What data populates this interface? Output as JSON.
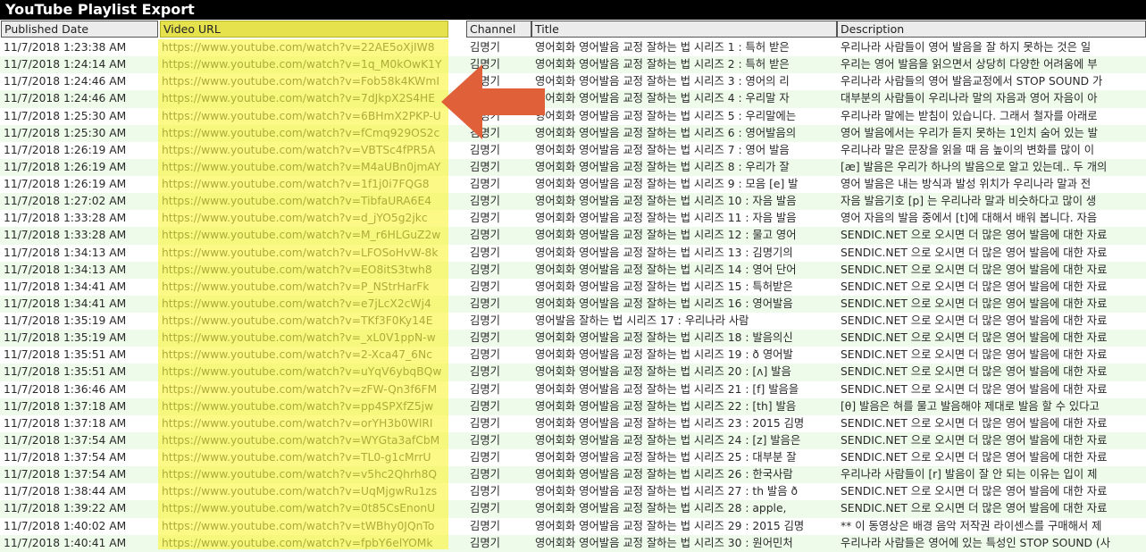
{
  "window": {
    "title": "YouTube Playlist Export"
  },
  "columns": [
    "Published Date",
    "Video URL",
    "Channel",
    "Title",
    "Description"
  ],
  "colors": {
    "url_highlight": "#f6f23c",
    "arrow": "#e0603a",
    "row_alt": "#eefbea"
  },
  "annotation": {
    "arrow_icon": "left-arrow-icon"
  },
  "rows": [
    {
      "date": "11/7/2018 1:23:38 AM",
      "url": "https://www.youtube.com/watch?v=22AE5oXjIW8",
      "channel": "김명기",
      "title": "영어회화 영어발음 교정 잘하는 법 시리즈 1 : 특허 받은",
      "desc": "우리나라 사람들이 영어 발음을 잘 하지 못하는 것은 일"
    },
    {
      "date": "11/7/2018 1:24:14 AM",
      "url": "https://www.youtube.com/watch?v=1q_M0kOwK1Y",
      "channel": "김명기",
      "title": "영어회화 영어발음 교정 잘하는 법 시리즈 2 : 특허 받은",
      "desc": "우리는 영어 발음을 읽으면서 상당히 다양한 어려움에 부"
    },
    {
      "date": "11/7/2018 1:24:46 AM",
      "url": "https://www.youtube.com/watch?v=Fob58k4KWmI",
      "channel": "김명기",
      "title": "영어회화 영어발음 교정 잘하는 법 시리즈 3 : 영어의 리",
      "desc": "우리나라 사람들의 영어 발음교정에서 STOP SOUND 가"
    },
    {
      "date": "11/7/2018 1:24:46 AM",
      "url": "https://www.youtube.com/watch?v=7dJkpX2S4HE",
      "channel": "김명기",
      "title": "영어회화 영어발음 교정 잘하는 법 시리즈 4 : 우리말 자",
      "desc": "대부분의 사람들이 우리나라 말의 자음과 영어 자음이 아"
    },
    {
      "date": "11/7/2018 1:25:30 AM",
      "url": "https://www.youtube.com/watch?v=6BHmX2PKP-U",
      "channel": "김명기",
      "title": "영어회화 영어발음 교정 잘하는 법 시리즈 5 : 우리말에는",
      "desc": "우리나라 말에는 받침이 있습니다. 그래서 철자를 아래로"
    },
    {
      "date": "11/7/2018 1:25:30 AM",
      "url": "https://www.youtube.com/watch?v=fCmq929OS2c",
      "channel": "김명기",
      "title": "영어회화 영어발음 교정 잘하는 법 시리즈 6 : 영어발음의",
      "desc": "영어 발음에서는 우리가 듣지 못하는 1인치 숨어 있는 발"
    },
    {
      "date": "11/7/2018 1:26:19 AM",
      "url": "https://www.youtube.com/watch?v=VBTSc4fPR5A",
      "channel": "김명기",
      "title": "영어회화 영어발음 교정 잘하는 법 시리즈 7 : 영어 발음",
      "desc": "우리나라 말은 문장을 읽을 때 음 높이의 변화를 많이 이"
    },
    {
      "date": "11/7/2018 1:26:19 AM",
      "url": "https://www.youtube.com/watch?v=M4aUBn0jmAY",
      "channel": "김명기",
      "title": "영어회화 영어발음 교정 잘하는 법 시리즈 8 : 우리가 잘",
      "desc": "[æ] 발음은 우리가 하나의 발음으로 알고 있는데.. 두 개의"
    },
    {
      "date": "11/7/2018 1:26:19 AM",
      "url": "https://www.youtube.com/watch?v=1f1j0i7FQG8",
      "channel": "김명기",
      "title": "영어회화 영어발음 교정 잘하는 법 시리즈 9 : 모음 [e] 발",
      "desc": "영어 발음은 내는 방식과 발성 위치가 우리나라 말과 전"
    },
    {
      "date": "11/7/2018 1:27:02 AM",
      "url": "https://www.youtube.com/watch?v=TibfaURA6E4",
      "channel": "김명기",
      "title": "영어회화 영어발음 교정 잘하는 법 시리즈 10 : 자음 발음",
      "desc": "자음 발음기호 [p] 는 우리나라 말과 비슷하다고 많이 생"
    },
    {
      "date": "11/7/2018 1:33:28 AM",
      "url": "https://www.youtube.com/watch?v=d_jYO5g2jkc",
      "channel": "김명기",
      "title": "영어회화 영어발음 교정 잘하는 법 시리즈 11 : 자음 발음",
      "desc": "영어 자음의 발음 중에서 [t]에 대해서 배워 봅니다. 자음"
    },
    {
      "date": "11/7/2018 1:33:28 AM",
      "url": "https://www.youtube.com/watch?v=M_r6HLGuZ2w",
      "channel": "김명기",
      "title": "영어회화 영어발음 교정 잘하는 법 시리즈 12 : 물고 영어",
      "desc": "SENDIC.NET 으로 오시면 더 많은 영어 발음에 대한 자료"
    },
    {
      "date": "11/7/2018 1:34:13 AM",
      "url": "https://www.youtube.com/watch?v=LFOSoHvW-8k",
      "channel": "김명기",
      "title": "영어회화 영어발음 교정 잘하는 법 시리즈 13 : 김명기의",
      "desc": "SENDIC.NET 으로 오시면 더 많은 영어 발음에 대한 자료"
    },
    {
      "date": "11/7/2018 1:34:13 AM",
      "url": "https://www.youtube.com/watch?v=EO8itS3twh8",
      "channel": "김명기",
      "title": "영어회화 영어발음 교정 잘하는 법 시리즈 14 : 영어 단어",
      "desc": "SENDIC.NET 으로 오시면 더 많은 영어 발음에 대한 자료"
    },
    {
      "date": "11/7/2018 1:34:41 AM",
      "url": "https://www.youtube.com/watch?v=P_NStrHarFk",
      "channel": "김명기",
      "title": "영어회화 영어발음 교정 잘하는 법 시리즈 15 : 특허받은",
      "desc": "SENDIC.NET 으로 오시면 더 많은 영어 발음에 대한 자료"
    },
    {
      "date": "11/7/2018 1:34:41 AM",
      "url": "https://www.youtube.com/watch?v=e7jLcX2cWj4",
      "channel": "김명기",
      "title": "영어회화 영어발음 교정 잘하는 법 시리즈 16 : 영어발음",
      "desc": "SENDIC.NET 으로 오시면 더 많은 영어 발음에 대한 자료"
    },
    {
      "date": "11/7/2018 1:35:19 AM",
      "url": "https://www.youtube.com/watch?v=TKf3F0Ky14E",
      "channel": "김명기",
      "title": "영어발음 잘하는 법 시리즈 17 : 우리나라 사람",
      "desc": "SENDIC.NET 으로 오시면 더 많은 영어 발음에 대한 자료"
    },
    {
      "date": "11/7/2018 1:35:19 AM",
      "url": "https://www.youtube.com/watch?v=_xL0V1ppN-w",
      "channel": "김명기",
      "title": "영어회화 영어발음 교정 잘하는 법 시리즈 18 : 발음의신",
      "desc": "SENDIC.NET 으로 오시면 더 많은 영어 발음에 대한 자료"
    },
    {
      "date": "11/7/2018 1:35:51 AM",
      "url": "https://www.youtube.com/watch?v=2-Xca47_6Nc",
      "channel": "김명기",
      "title": "영어회화 영어발음 교정 잘하는 법 시리즈 19 : ð 영어발",
      "desc": "SENDIC.NET 으로 오시면 더 많은 영어 발음에 대한 자료"
    },
    {
      "date": "11/7/2018 1:35:51 AM",
      "url": "https://www.youtube.com/watch?v=uYqV6ybqBQw",
      "channel": "김명기",
      "title": "영어회화 영어발음 교정 잘하는 법 시리즈 20 : [ʌ] 발음",
      "desc": "SENDIC.NET 으로 오시면 더 많은 영어 발음에 대한 자료"
    },
    {
      "date": "11/7/2018 1:36:46 AM",
      "url": "https://www.youtube.com/watch?v=zFW-Qn3f6FM",
      "channel": "김명기",
      "title": "영어회화 영어발음 교정 잘하는 법 시리즈 21 : [f] 발음을",
      "desc": "SENDIC.NET 으로 오시면 더 많은 영어 발음에 대한 자료"
    },
    {
      "date": "11/7/2018 1:37:18 AM",
      "url": "https://www.youtube.com/watch?v=pp4SPXfZ5jw",
      "channel": "김명기",
      "title": "영어회화 영어발음 교정 잘하는 법 시리즈 22 : [th] 발음",
      "desc": "[θ] 발음은 혀를 물고 발음해야 제대로 발음 할 수 있다고"
    },
    {
      "date": "11/7/2018 1:37:18 AM",
      "url": "https://www.youtube.com/watch?v=orYH3b0WlRI",
      "channel": "김명기",
      "title": "영어회화 영어발음 교정 잘하는 법 시리즈 23 : 2015 김명",
      "desc": "SENDIC.NET 으로 오시면 더 많은 영어 발음에 대한 자료"
    },
    {
      "date": "11/7/2018 1:37:54 AM",
      "url": "https://www.youtube.com/watch?v=WYGta3afCbM",
      "channel": "김명기",
      "title": "영어회화 영어발음 교정 잘하는 법 시리즈 24 : [z] 발음은",
      "desc": "SENDIC.NET 으로 오시면 더 많은 영어 발음에 대한 자료"
    },
    {
      "date": "11/7/2018 1:37:54 AM",
      "url": "https://www.youtube.com/watch?v=TL0-g1cMrrU",
      "channel": "김명기",
      "title": "영어회화 영어발음 교정 잘하는 법 시리즈 25 : 대부분 잘",
      "desc": "SENDIC.NET 으로 오시면 더 많은 영어 발음에 대한 자료"
    },
    {
      "date": "11/7/2018 1:37:54 AM",
      "url": "https://www.youtube.com/watch?v=v5hc2Qhrh8Q",
      "channel": "김명기",
      "title": "영어회화 영어발음 교정 잘하는 법 시리즈 26 : 한국사람",
      "desc": "우리나라 사람들이 [r] 발음이 잘 안 되는 이유는 입이 제"
    },
    {
      "date": "11/7/2018 1:38:44 AM",
      "url": "https://www.youtube.com/watch?v=UqMjgwRu1zs",
      "channel": "김명기",
      "title": "영어회화 영어발음 교정 잘하는 법 시리즈 27 : th 발음 ð",
      "desc": "SENDIC.NET 으로 오시면 더 많은 영어 발음에 대한 자료"
    },
    {
      "date": "11/7/2018 1:39:22 AM",
      "url": "https://www.youtube.com/watch?v=0t85CsEnonU",
      "channel": "김명기",
      "title": "영어회화 영어발음 교정 잘하는 법 시리즈 28 : apple,",
      "desc": "SENDIC.NET 으로 오시면 더 많은 영어 발음에 대한 자료"
    },
    {
      "date": "11/7/2018 1:40:02 AM",
      "url": "https://www.youtube.com/watch?v=tWBhy0JQnTo",
      "channel": "김명기",
      "title": "영어회화 영어발음 교정 잘하는 법 시리즈 29 : 2015 김명",
      "desc": "** 이 동영상은 배경 음악 저작권 라이센스를 구매해서 제"
    },
    {
      "date": "11/7/2018 1:40:41 AM",
      "url": "https://www.youtube.com/watch?v=fpbY6elYOMk",
      "channel": "김명기",
      "title": "영어회화 영어발음 교정 잘하는 법 시리즈 30 : 원어민처",
      "desc": "우리나라 사람들은 영어에 있는 특성인 STOP SOUND (사"
    }
  ]
}
